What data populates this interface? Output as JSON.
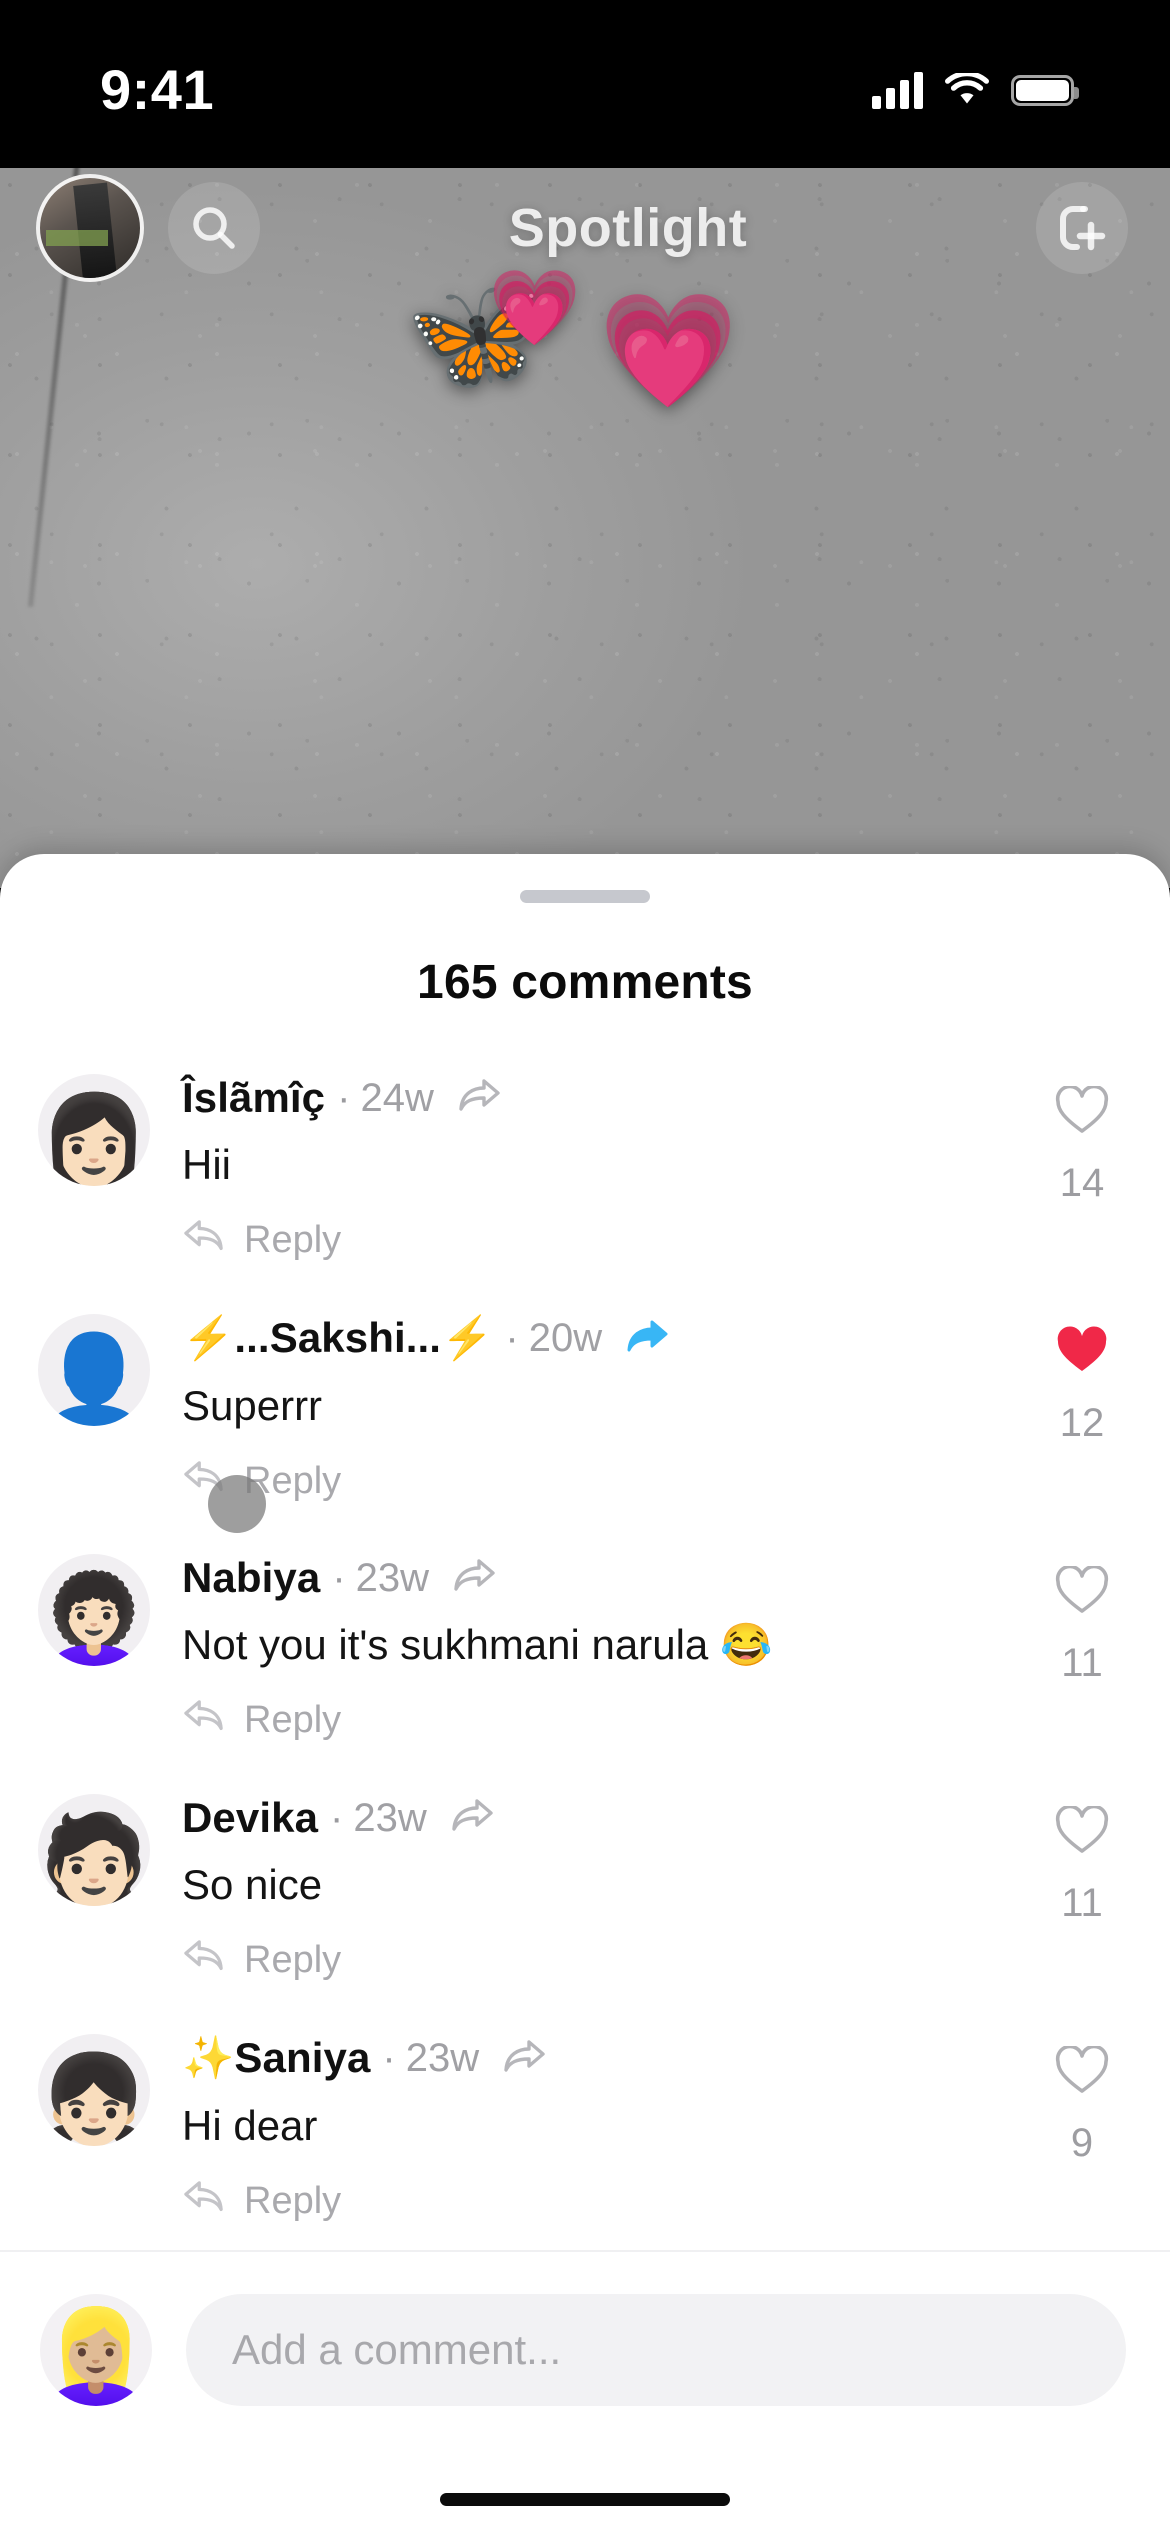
{
  "status_bar": {
    "time": "9:41",
    "cellular_icon": "cellular-signal-icon",
    "wifi_icon": "wifi-icon",
    "battery_icon": "battery-full-icon"
  },
  "header": {
    "profile_icon": "profile-avatar",
    "search_icon": "search-icon",
    "title": "Spotlight",
    "add_friend_icon": "add-friend-ghost-icon"
  },
  "video": {
    "emojis": [
      "🦋",
      "💗",
      "💗"
    ],
    "butterfly": "🦋",
    "heart_big": "💗",
    "heart_small": "💗"
  },
  "sheet": {
    "grabber": "drag-handle",
    "title": "165 comments",
    "comment_count": 165
  },
  "comments": [
    {
      "avatar_emoji": "👩🏻",
      "name": "Îslãmîç",
      "separator": "·",
      "time": "24w",
      "share_icon": "share-arrow-icon",
      "verified_icon": "",
      "text": "Hii",
      "reply_label": "Reply",
      "reply_icon": "reply-arrow-icon",
      "like_icon": "heart-outline-icon",
      "liked": false,
      "likes": "14"
    },
    {
      "avatar_emoji": "👤",
      "name": "⚡...Sakshi...⚡",
      "separator": "·",
      "time": "20w",
      "share_icon": "share-arrow-filled-blue-icon",
      "verified_icon": "",
      "text": "Superrr",
      "reply_label": "Reply",
      "reply_icon": "reply-arrow-icon",
      "like_icon": "heart-filled-icon",
      "liked": true,
      "likes": "12"
    },
    {
      "avatar_emoji": "👩🏻‍🦱",
      "name": "Nabiya",
      "separator": "·",
      "time": "23w",
      "share_icon": "share-arrow-icon",
      "verified_icon": "",
      "text": "Not you it's sukhmani narula 😂",
      "reply_label": "Reply",
      "reply_icon": "reply-arrow-icon",
      "like_icon": "heart-outline-icon",
      "liked": false,
      "likes": "11"
    },
    {
      "avatar_emoji": "🧑🏻",
      "name": "Devika",
      "separator": "·",
      "time": "23w",
      "share_icon": "share-arrow-icon",
      "verified_icon": "",
      "text": "So nice",
      "reply_label": "Reply",
      "reply_icon": "reply-arrow-icon",
      "like_icon": "heart-outline-icon",
      "liked": false,
      "likes": "11"
    },
    {
      "avatar_emoji": "👧🏻",
      "name": "✨Saniya",
      "separator": "·",
      "time": "23w",
      "share_icon": "share-arrow-icon",
      "verified_icon": "",
      "text": "Hi dear",
      "reply_label": "Reply",
      "reply_icon": "reply-arrow-icon",
      "like_icon": "heart-outline-icon",
      "liked": false,
      "likes": "9"
    }
  ],
  "composer": {
    "avatar_emoji": "👱🏼‍♀️",
    "placeholder": "Add a comment..."
  },
  "colors": {
    "sheet_background": "#ffffff",
    "liked_heart": "#f02848",
    "blue_arrow": "#38b6f5",
    "muted_text": "#a0a0a4",
    "primary_text": "#111111",
    "field_background": "#f2f2f4"
  },
  "home_indicator": "home-indicator"
}
